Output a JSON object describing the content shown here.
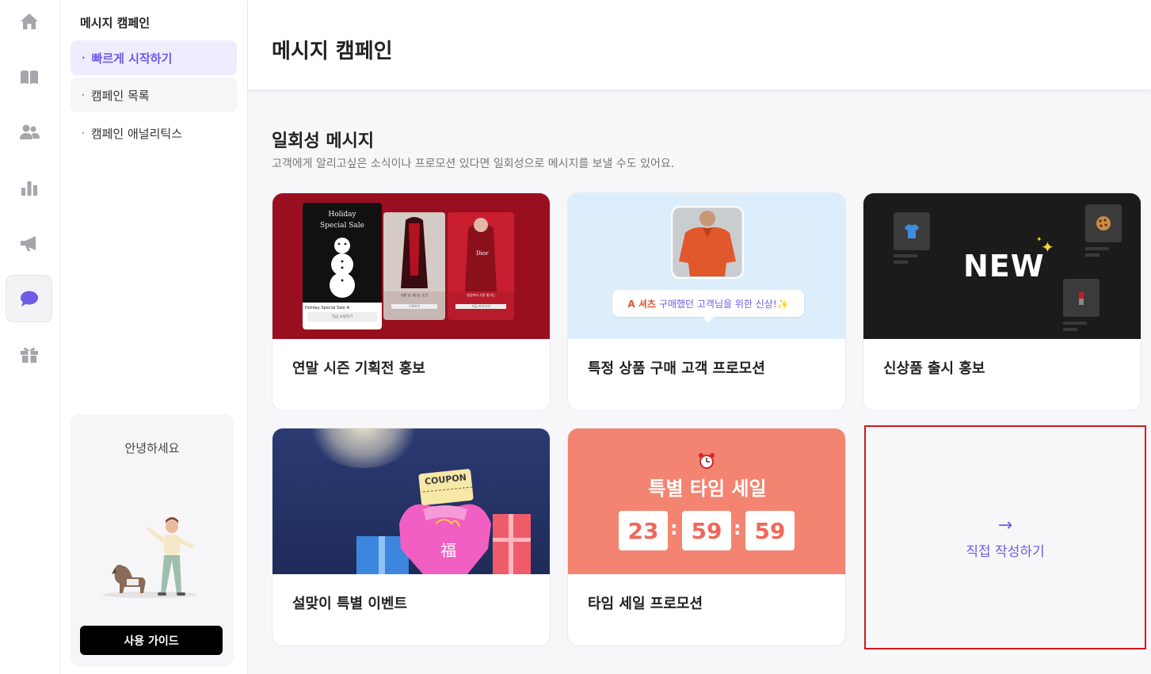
{
  "subnav": {
    "title": "메시지 캠페인",
    "items": [
      {
        "label": "빠르게 시작하기"
      },
      {
        "label": "캠페인 목록"
      },
      {
        "label": "캠페인 애널리틱스"
      }
    ]
  },
  "greeting": {
    "text": "안녕하세요",
    "button": "사용 가이드"
  },
  "header": {
    "title": "메시지 캠페인"
  },
  "section": {
    "title": "일회성 메시지",
    "description": "고객에게 알리고싶은 소식이나 프로모션 있다면 일회성으로 메시지를 보낼 수도 있어요."
  },
  "cards": [
    {
      "label": "연말 시즌 기획전 홍보",
      "image_text": {
        "sale_title": "Holiday Special Sale",
        "caption": "Holiday Special Sale ❄",
        "button": "지금 쇼핑하기",
        "side_caption1": "가을 날, 빛나는 순간",
        "side_caption2": "일상에서 가장 빛나는",
        "side_btn1": "구경하기",
        "side_btn2": "지금 보러가기",
        "brand": "Dior"
      }
    },
    {
      "label": "특정 상품 구매 고객 프로모션",
      "image_text": {
        "product": "A 셔츠",
        "message": "구매했던 고객님을 위한 신상!✨"
      }
    },
    {
      "label": "신상품 출시 홍보",
      "image_text": {
        "badge": "NEW"
      }
    },
    {
      "label": "설맞이 특별 이벤트",
      "image_text": {
        "coupon": "COUPON",
        "char": "福"
      }
    },
    {
      "label": "타임 세일 프로모션",
      "image_text": {
        "title": "특별 타임 세일",
        "hours": "23",
        "minutes": "59",
        "seconds": "59"
      }
    }
  ],
  "direct": {
    "arrow": "→",
    "label": "직접 작성하기"
  },
  "colors": {
    "accent": "#6d5ce8",
    "highlight_border": "#d4181e",
    "card1_bg": "#9a0f1f",
    "card2_bg": "#dceefb",
    "card3_bg": "#1b1b1b",
    "card4_bg": "#1f2c5a",
    "card5_bg": "#f38471"
  },
  "icons": [
    "home-icon",
    "book-icon",
    "users-icon",
    "bar-chart-icon",
    "megaphone-icon",
    "chat-icon",
    "gift-icon"
  ]
}
